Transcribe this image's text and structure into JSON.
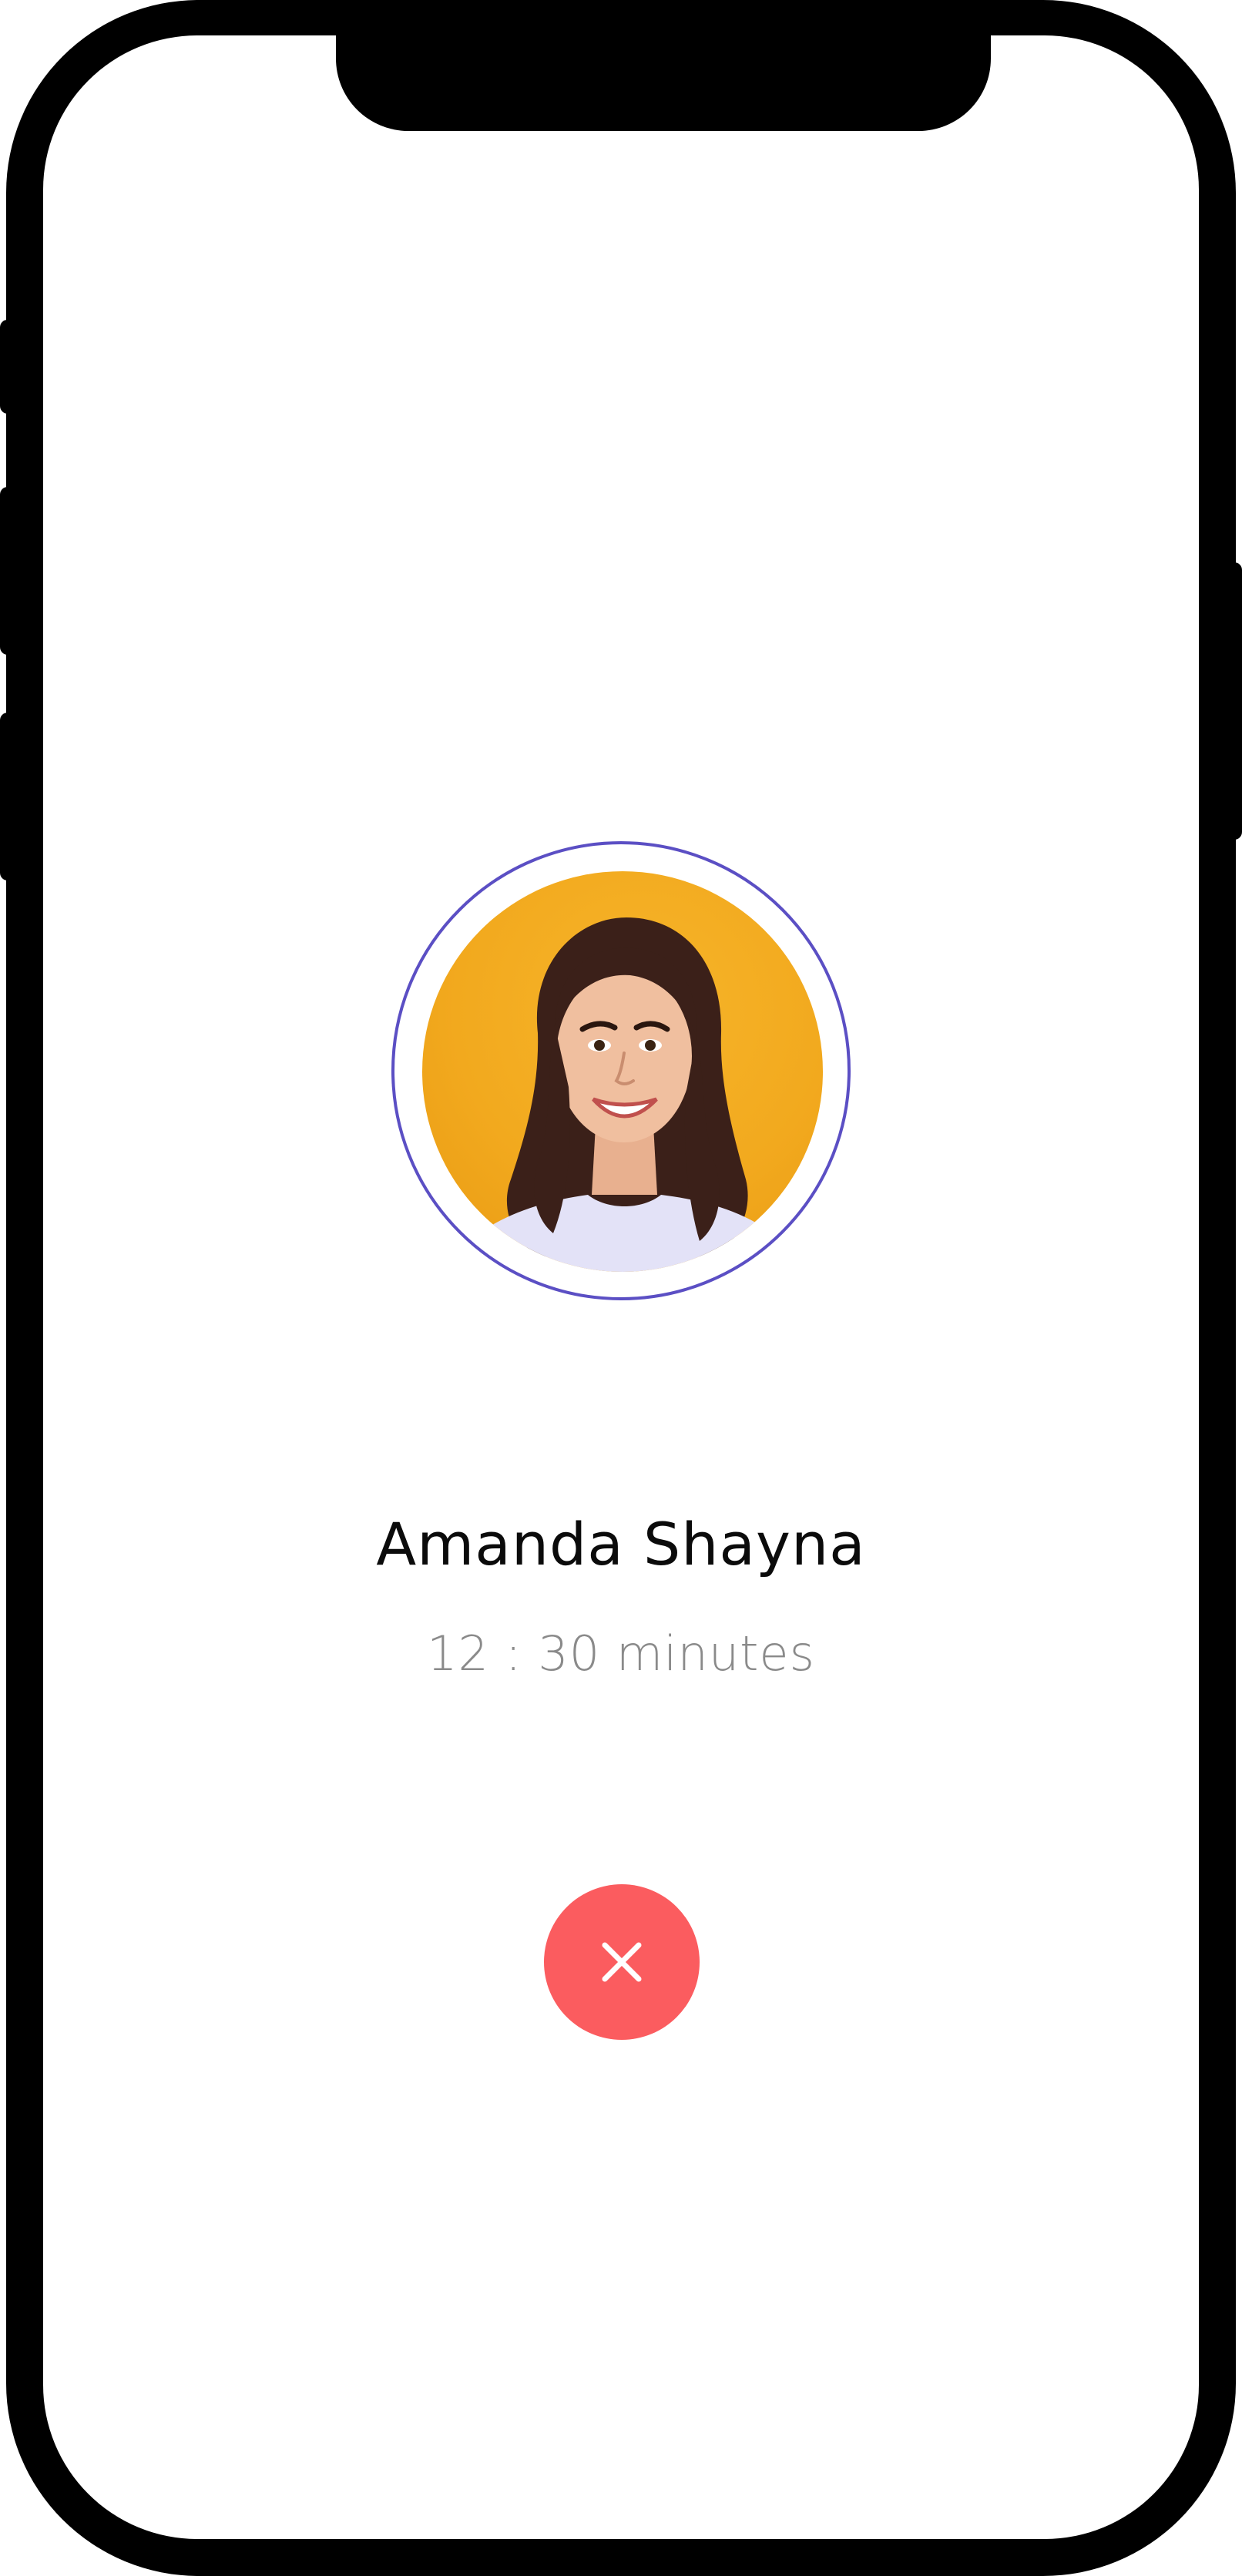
{
  "call": {
    "caller_name": "Amanda Shayna",
    "duration": "12 : 30 minutes"
  },
  "avatar": {
    "description_icon": "woman-portrait",
    "background_color": "#F4AE22",
    "ring_color": "#5B4FC4"
  },
  "end_call": {
    "icon": "close-icon",
    "color": "#FB5C5F"
  }
}
